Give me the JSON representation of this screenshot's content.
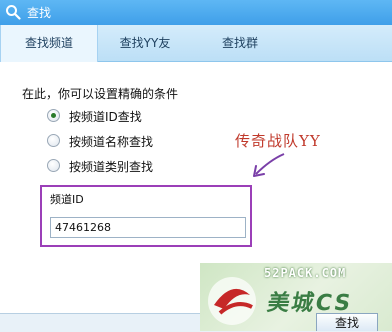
{
  "window": {
    "title": "查找",
    "icon": "search-icon"
  },
  "tabs": [
    {
      "label": "查找频道",
      "active": true
    },
    {
      "label": "查找YY友",
      "active": false
    },
    {
      "label": "查找群",
      "active": false
    }
  ],
  "form": {
    "hint": "在此，你可以设置精确的条件",
    "options": [
      {
        "label": "按频道ID查找",
        "checked": true
      },
      {
        "label": "按频道名称查找",
        "checked": false
      },
      {
        "label": "按频道类别查找",
        "checked": false
      }
    ],
    "group_label": "频道ID",
    "channel_id_value": "47461268"
  },
  "annotation": {
    "text": "传奇战队YY",
    "color": "#c0392b"
  },
  "watermark": {
    "url": "52PACK.COM",
    "name": "美城CS"
  },
  "footer": {
    "search_label": "查找"
  }
}
